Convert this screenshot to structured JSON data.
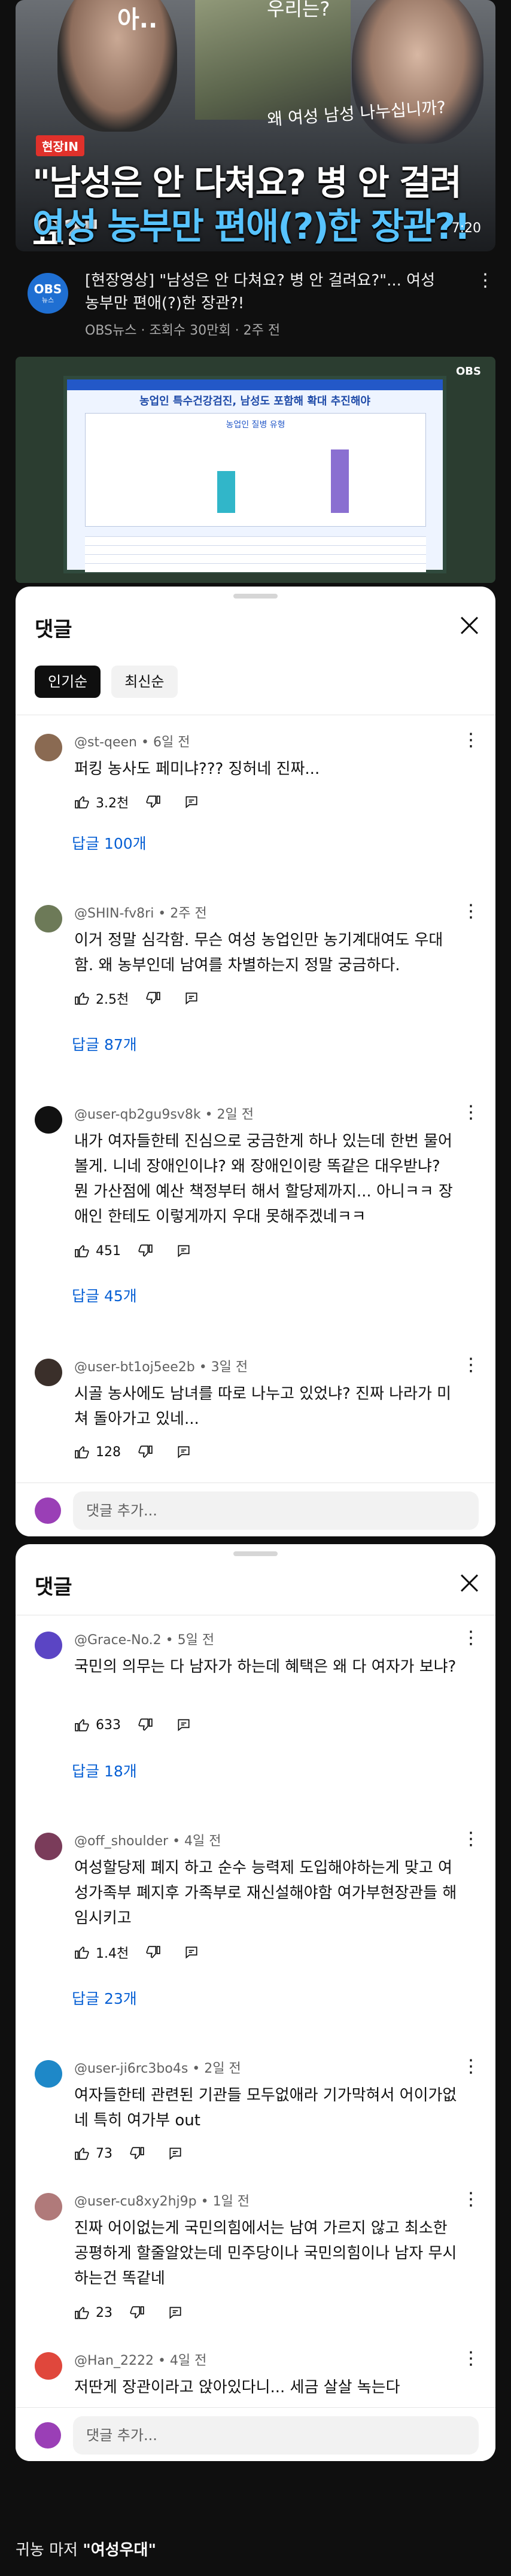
{
  "thumbnail": {
    "top_text_left": "아..",
    "top_text_right": "우리는?",
    "sub_quote": "왜 여성 남성 나누십니까?",
    "tag": "현장IN",
    "headline_line1": "\"남성은 안 다쳐요? 병 안 걸려요?\"",
    "headline_line2": "여성 농부만 편애(?)한 장관?!",
    "duration": "7:20"
  },
  "video": {
    "channel_logo": "OBS",
    "channel_logo_sub": "뉴스",
    "title": "[현장영상] \"남성은 안 다쳐요? 병 안 걸려요?\"... 여성 농부만 편애(?)한 장관?!",
    "meta": "OBS뉴스 · 조회수 30만회 · 2주 전",
    "more_icon": "more-vert-icon"
  },
  "still": {
    "obs_mark": "OBS",
    "screen_title": "농업인 특수건강검진, 남성도 포함해 확대 추진해야",
    "chart_label": "농업인 질병 유형"
  },
  "sheet1": {
    "title": "댓글",
    "chips": [
      "인기순",
      "최신순"
    ],
    "comments": [
      {
        "handle": "@st-qeen • 6일 전",
        "text": "퍼킹 농사도 페미냐??? 징허네 진짜...",
        "likes": "3.2천",
        "replies": "답글 100개",
        "avatar_color": "#8a6a52"
      },
      {
        "handle": "@SHIN-fv8ri • 2주 전",
        "text": "이거 정말 심각함. 무슨 여성 농업인만 농기계대여도 우대함. 왜 농부인데 남여를 차별하는지 정말 궁금하다.",
        "likes": "2.5천",
        "replies": "답글 87개",
        "avatar_color": "#6d7a58"
      },
      {
        "handle": "@user-qb2gu9sv8k • 2일 전",
        "text": "내가 여자들한테 진심으로 궁금한게 하나 있는데 한번 물어볼게. 니네 장애인이냐? 왜 장애인이랑 똑같은 대우받냐? 뭔 가산점에 예산 책정부터 해서 할당제까지... 아니ㅋㅋ 장애인 한테도 이렇게까지 우대 못해주겠네ㅋㅋ",
        "likes": "451",
        "replies": "답글 45개",
        "avatar_color": "#111111"
      },
      {
        "handle": "@user-bt1oj5ee2b • 3일 전",
        "text": "시골 농사에도 남녀를 따로 나누고 있었냐? 진짜 나라가 미쳐 돌아가고 있네...",
        "likes": "128",
        "avatar_color": "#3a2f2a"
      }
    ],
    "add_placeholder": "댓글 추가..."
  },
  "sheet2": {
    "title": "댓글",
    "comments": [
      {
        "handle": "@Grace-No.2 • 5일 전",
        "text": "국민의 의무는 다 남자가 하는데 혜택은 왜 다 여자가 보냐?",
        "likes": "633",
        "replies": "답글 18개",
        "avatar_color": "#5b45c4"
      },
      {
        "handle": "@off_shoulder • 4일 전",
        "text": "여성할당제 폐지 하고 순수 능력제 도입해야하는게 맞고 여성가족부 폐지후 가족부로 재신설해야함 여가부현장관들 해임시키고",
        "likes": "1.4천",
        "replies": "답글 23개",
        "avatar_color": "#7a3c5a"
      },
      {
        "handle": "@user-ji6rc3bo4s • 2일 전",
        "text": "여자들한테 관련된 기관들 모두없애라 기가막혀서 어이가없네 특히 여가부 out",
        "likes": "73",
        "avatar_color": "#1e88c8"
      },
      {
        "handle": "@user-cu8xy2hj9p • 1일 전",
        "text": "진짜 어이없는게 국민의힘에서는 남여 가르지 않고 최소한 공평하게 할줄알았는데 민주당이나 국민의힘이나 남자 무시하는건 똑같네",
        "likes": "23",
        "avatar_color": "#b07a7a"
      },
      {
        "handle": "@Han_2222 • 4일 전",
        "text": "저딴게 장관이라고 앉아있다니... 세금 살살 녹는다",
        "avatar_color": "#e0473c"
      }
    ],
    "add_placeholder": "댓글 추가..."
  },
  "footer": {
    "caption_prefix": "귀농 마저 ",
    "caption_quote": "\"여성우대\""
  },
  "icons": {
    "like": "thumb-up-icon",
    "dislike": "thumb-down-icon",
    "reply": "reply-icon",
    "close": "close-icon",
    "more": "more-vert-icon"
  }
}
